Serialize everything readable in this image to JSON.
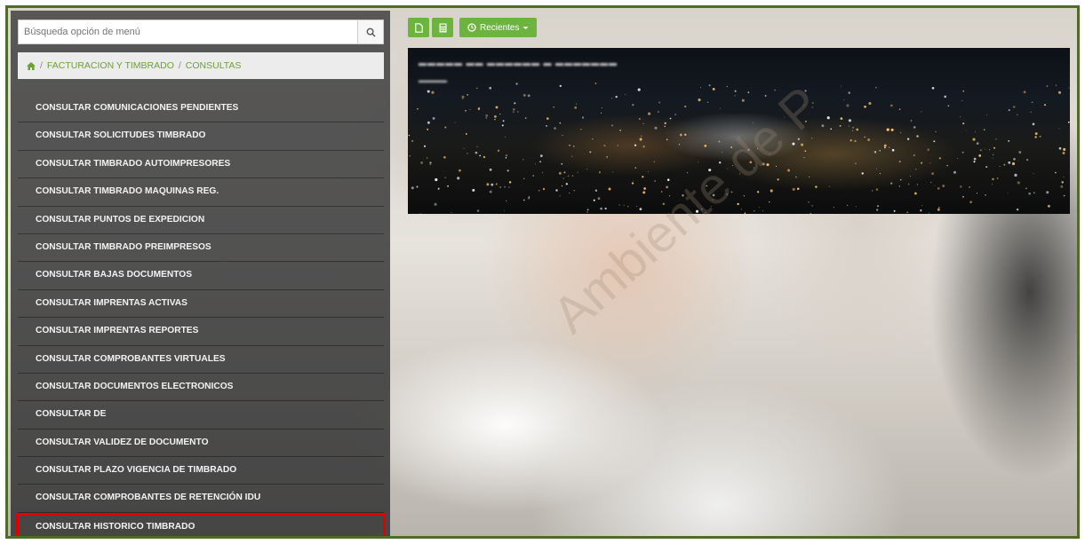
{
  "search": {
    "placeholder": "Búsqueda opción de menú"
  },
  "breadcrumb": {
    "home_icon": "home-icon",
    "items": [
      "FACTURACION Y TIMBRADO",
      "CONSULTAS"
    ]
  },
  "menu": {
    "items": [
      "CONSULTAR COMUNICACIONES PENDIENTES",
      "CONSULTAR SOLICITUDES TIMBRADO",
      "CONSULTAR TIMBRADO AUTOIMPRESORES",
      "CONSULTAR TIMBRADO MAQUINAS REG.",
      "CONSULTAR PUNTOS DE EXPEDICION",
      "CONSULTAR TIMBRADO PREIMPRESOS",
      "CONSULTAR BAJAS DOCUMENTOS",
      "CONSULTAR IMPRENTAS ACTIVAS",
      "CONSULTAR IMPRENTAS REPORTES",
      "CONSULTAR COMPROBANTES VIRTUALES",
      "CONSULTAR DOCUMENTOS ELECTRONICOS",
      "CONSULTAR DE",
      "CONSULTAR VALIDEZ DE DOCUMENTO",
      "CONSULTAR PLAZO VIGENCIA DE TIMBRADO",
      "CONSULTAR COMPROBANTES DE RETENCIÓN IDU",
      "CONSULTAR HISTORICO TIMBRADO"
    ],
    "highlighted_index": 15
  },
  "toolbar": {
    "recent_label": "Recientes"
  },
  "watermark": "Ambiente de P",
  "colors": {
    "accent": "#6db33f",
    "frame": "#4f6b2a",
    "highlight": "#e00000",
    "sidebar": "#464646"
  }
}
